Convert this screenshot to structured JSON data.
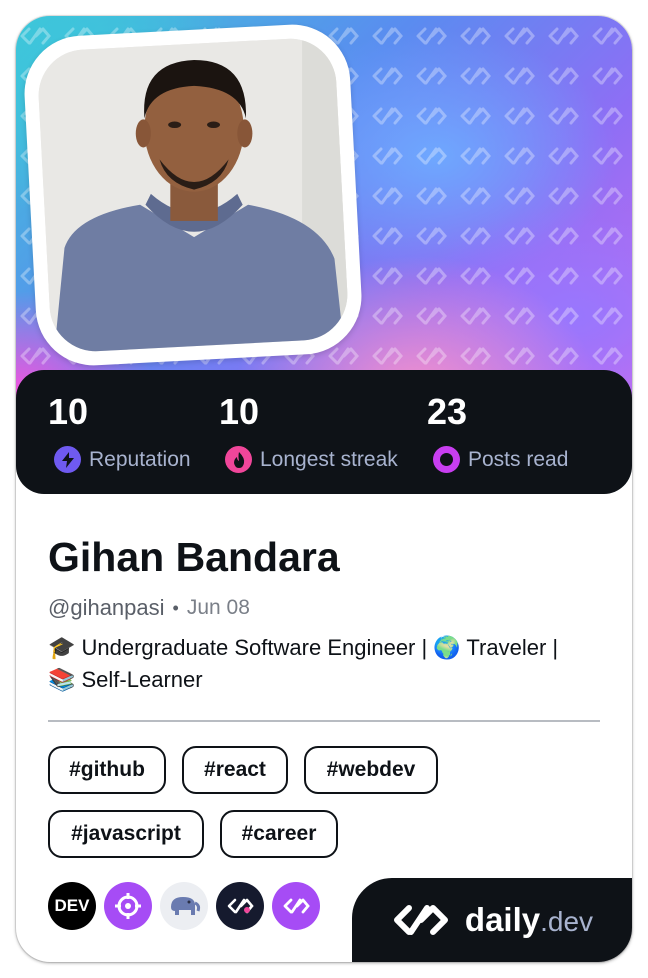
{
  "profile": {
    "name": "Gihan Bandara",
    "handle": "@gihanpasi",
    "separator": "•",
    "joined": "Jun 08",
    "bio_line1": "🎓 Undergraduate Software Engineer | 🌍 Traveler |",
    "bio_line2": "📚 Self-Learner"
  },
  "stats": [
    {
      "value": "10",
      "label": "Reputation",
      "icon": "lightning-icon",
      "color": "#6f5af0"
    },
    {
      "value": "10",
      "label": "Longest streak",
      "icon": "flame-icon",
      "color": "#f0469a"
    },
    {
      "value": "23",
      "label": "Posts read",
      "icon": "ring-icon",
      "color": "#c83ef0"
    }
  ],
  "tags": [
    "#github",
    "#react",
    "#webdev",
    "#javascript",
    "#career"
  ],
  "sources": [
    {
      "name": "dev-to-icon",
      "label": "DEV"
    },
    {
      "name": "crosshair-source-icon"
    },
    {
      "name": "php-elephant-icon"
    },
    {
      "name": "dailydev-dark-icon"
    },
    {
      "name": "dailydev-purple-icon"
    }
  ],
  "brand": {
    "name": "daily",
    "suffix": ".dev"
  },
  "colors": {
    "dark": "#0e1217",
    "muted": "#a8b3cf",
    "accent_purple": "#7c3aed"
  }
}
